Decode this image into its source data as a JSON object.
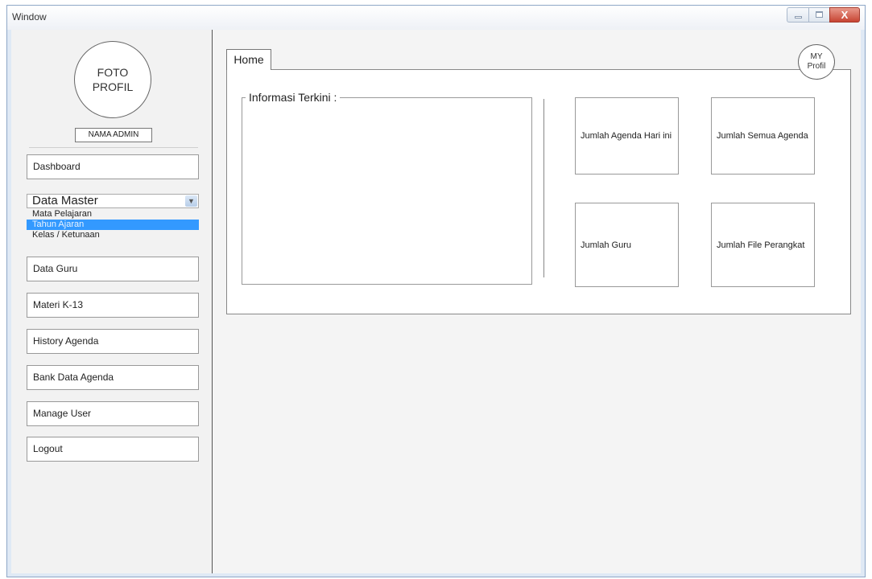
{
  "window": {
    "title": "Window",
    "close_glyph": "X"
  },
  "sidebar": {
    "avatar_text": "FOTO PROFIL",
    "admin_name": "NAMA ADMIN",
    "menu": {
      "dashboard": "Dashboard",
      "data_master": "Data Master",
      "data_guru": "Data Guru",
      "materi": "Materi K-13",
      "history": "History Agenda",
      "bank": "Bank Data Agenda",
      "manage_user": "Manage User",
      "logout": "Logout"
    },
    "data_master_options": [
      "Mata Pelajaran",
      "Tahun Ajaran",
      "Kelas / Ketunaan"
    ],
    "data_master_selected": "Tahun Ajaran"
  },
  "main": {
    "tab_label": "Home",
    "my_profil": "MY Profil",
    "info_title": "Informasi Terkini :",
    "stats": {
      "agenda_today": "Jumlah Agenda Hari ini",
      "all_agenda": "Jumlah Semua Agenda",
      "guru": "Jumlah Guru",
      "file_perangkat": "Jumlah File Perangkat"
    }
  },
  "colors": {
    "selection": "#3399ff",
    "close_button": "#c74433"
  }
}
